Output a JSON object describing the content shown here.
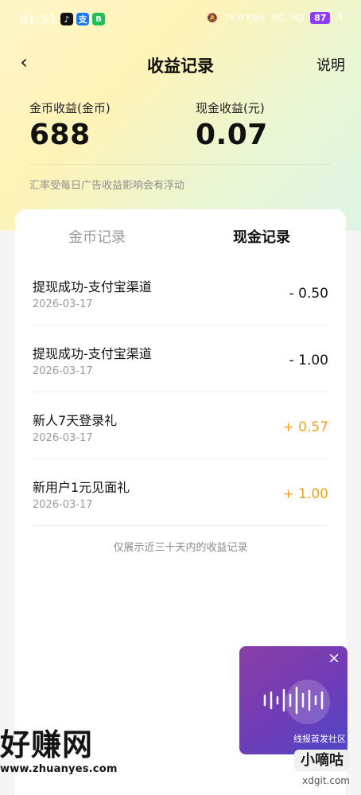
{
  "status_bar": {
    "time": "01:33",
    "speed": "19.0 KB/s",
    "signal": "5G",
    "wifi": "HD",
    "battery": "87"
  },
  "header": {
    "title": "收益记录",
    "back_icon": "chevron-left-icon",
    "explain": "说明"
  },
  "stats": {
    "coin_label": "金币收益(金币)",
    "coin_value": "688",
    "cash_label": "现金收益(元)",
    "cash_value": "0.07"
  },
  "notice": "汇率受每日广告收益影响会有浮动",
  "tabs": {
    "coin": "金币记录",
    "cash": "现金记录"
  },
  "records": [
    {
      "title": "提现成功-支付宝渠道",
      "date": "2026-03-17",
      "amount": "- 0.50",
      "amount_color": "#111111"
    },
    {
      "title": "提现成功-支付宝渠道",
      "date": "2026-03-17",
      "amount": "- 1.00",
      "amount_color": "#111111"
    },
    {
      "title": "新人7天登录礼",
      "date": "2026-03-17",
      "amount": "+ 0.57",
      "amount_color": "#f6a21a"
    },
    {
      "title": "新用户1元见面礼",
      "date": "2026-03-17",
      "amount": "+ 1.00",
      "amount_color": "#f6a21a"
    }
  ],
  "records_note": "仅展示近三十天内的收益记录",
  "floating_ad": {
    "text": "线报首发社区",
    "close_icon": "close-icon",
    "wave_icon": "audio-wave-icon"
  },
  "watermarks": {
    "left_big": "好赚网",
    "left_small": "www.zhuanyes.com",
    "right_badge": "小嘀咕",
    "right_site": "xdgit.com"
  }
}
